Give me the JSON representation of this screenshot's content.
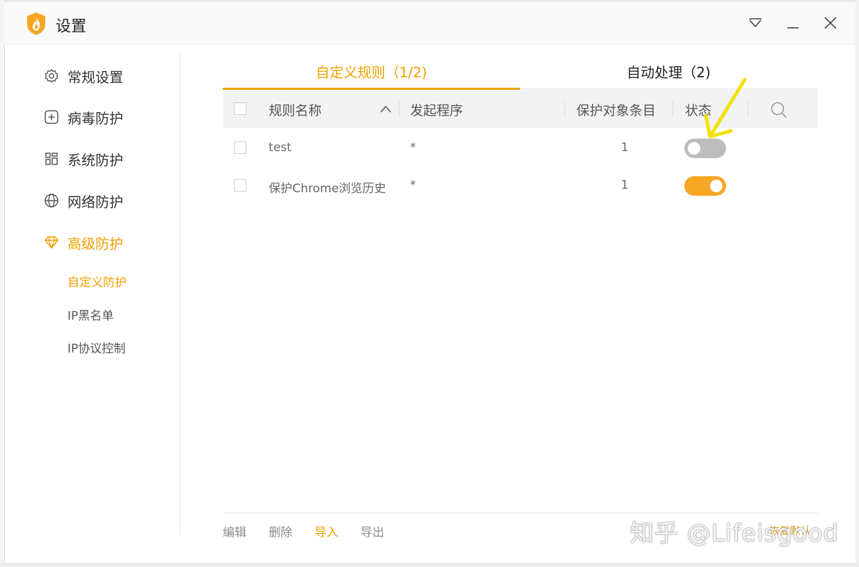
{
  "window": {
    "title": "设置"
  },
  "sidebar": {
    "items": [
      {
        "label": "常规设置",
        "icon": "gear-icon"
      },
      {
        "label": "病毒防护",
        "icon": "plus-square-icon"
      },
      {
        "label": "系统防护",
        "icon": "grid-icon"
      },
      {
        "label": "网络防护",
        "icon": "globe-icon"
      },
      {
        "label": "高级防护",
        "icon": "diamond-icon",
        "active": true
      }
    ],
    "subitems": [
      {
        "label": "自定义防护",
        "active": true
      },
      {
        "label": "IP黑名单"
      },
      {
        "label": "IP协议控制"
      }
    ]
  },
  "tabs": [
    {
      "label": "自定义规则（1/2)",
      "active": true
    },
    {
      "label": "自动处理（2)"
    }
  ],
  "table": {
    "headers": [
      "规则名称",
      "发起程序",
      "保护对象条目",
      "状态"
    ],
    "rows": [
      {
        "name": "test",
        "program": "*",
        "count": "1",
        "enabled": false
      },
      {
        "name": "保护Chrome浏览历史",
        "program": "*",
        "count": "1",
        "enabled": true
      }
    ]
  },
  "footer": {
    "buttons": [
      "编辑",
      "删除",
      "导入",
      "导出"
    ],
    "right_text": "恢复默认"
  },
  "watermark": "知乎 @Lifeisgood",
  "colors": {
    "accent": "#f0a000",
    "toggle_on": "#f5a623",
    "toggle_off": "#bdbdbd",
    "annotation_arrow": "#f2e20a"
  }
}
